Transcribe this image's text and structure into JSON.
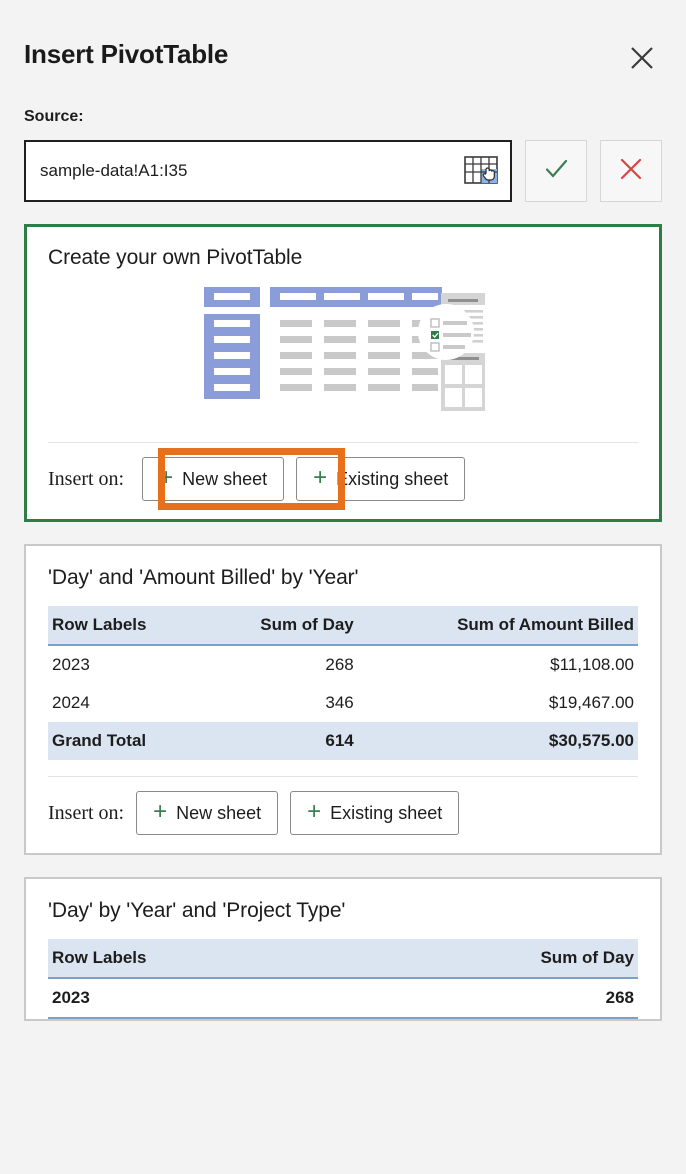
{
  "dialog": {
    "title": "Insert PivotTable",
    "close_icon": "close-icon"
  },
  "source": {
    "label": "Source:",
    "value": "sample-data!A1:I35",
    "placeholder": "",
    "range_picker_icon": "range-select-icon",
    "confirm_icon": "checkmark-icon",
    "cancel_icon": "cancel-x-icon",
    "accent_confirm_color": "#3c7d51",
    "accent_cancel_color": "#d64545"
  },
  "colors": {
    "page_background": "#f3f3f3",
    "selected_card_border": "#2e7d46",
    "card_border": "#c9c9c9",
    "highlight": "#e8701a",
    "table_header_bg": "#dbe5f1",
    "table_header_rule": "#7ba0cc",
    "plus_green": "#3c7d51"
  },
  "cards": [
    {
      "title": "Create your own PivotTable",
      "selected": true,
      "illustration": "pivottable-illustration",
      "insert_label": "Insert on:",
      "buttons": [
        {
          "label": "New sheet",
          "icon": "plus-icon",
          "highlighted": true
        },
        {
          "label": "Existing sheet",
          "icon": "plus-icon",
          "highlighted": false
        }
      ]
    },
    {
      "title": "'Day' and 'Amount Billed' by 'Year'",
      "selected": false,
      "insert_label": "Insert on:",
      "buttons": [
        {
          "label": "New sheet",
          "icon": "plus-icon",
          "highlighted": false
        },
        {
          "label": "Existing sheet",
          "icon": "plus-icon",
          "highlighted": false
        }
      ],
      "preview": {
        "columns": [
          "Row Labels",
          "Sum of Day",
          "Sum of Amount Billed"
        ],
        "rows": [
          {
            "cells": [
              "2023",
              "268",
              "$11,108.00"
            ],
            "total": false
          },
          {
            "cells": [
              "2024",
              "346",
              "$19,467.00"
            ],
            "total": false
          },
          {
            "cells": [
              "Grand Total",
              "614",
              "$30,575.00"
            ],
            "total": true
          }
        ]
      }
    },
    {
      "title": "'Day' by 'Year' and 'Project Type'",
      "selected": false,
      "preview": {
        "columns": [
          "Row Labels",
          "Sum of Day"
        ],
        "rows": [
          {
            "cells": [
              "2023",
              "268"
            ],
            "bold": true
          }
        ]
      }
    }
  ]
}
